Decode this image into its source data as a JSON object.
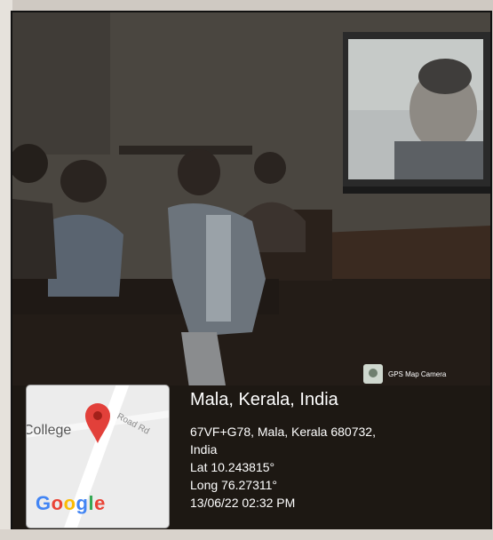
{
  "geotag": {
    "badge_label": "GPS Map Camera",
    "place_title": "Mala, Kerala, India",
    "address_line1": "67VF+G78, Mala, Kerala 680732,",
    "address_line2": "India",
    "latitude": "Lat 10.243815°",
    "longitude": "Long 76.27311°",
    "datetime": "13/06/22 02:32 PM"
  },
  "map": {
    "place_label": "College",
    "road_label": "Road Rd",
    "logo_letters": [
      "G",
      "o",
      "o",
      "g",
      "l",
      "e"
    ]
  },
  "colors": {
    "pin_red": "#e2403a",
    "google_blue": "#4285f4",
    "google_red": "#ea4335",
    "google_yellow": "#fbbc05",
    "google_green": "#34a853"
  }
}
